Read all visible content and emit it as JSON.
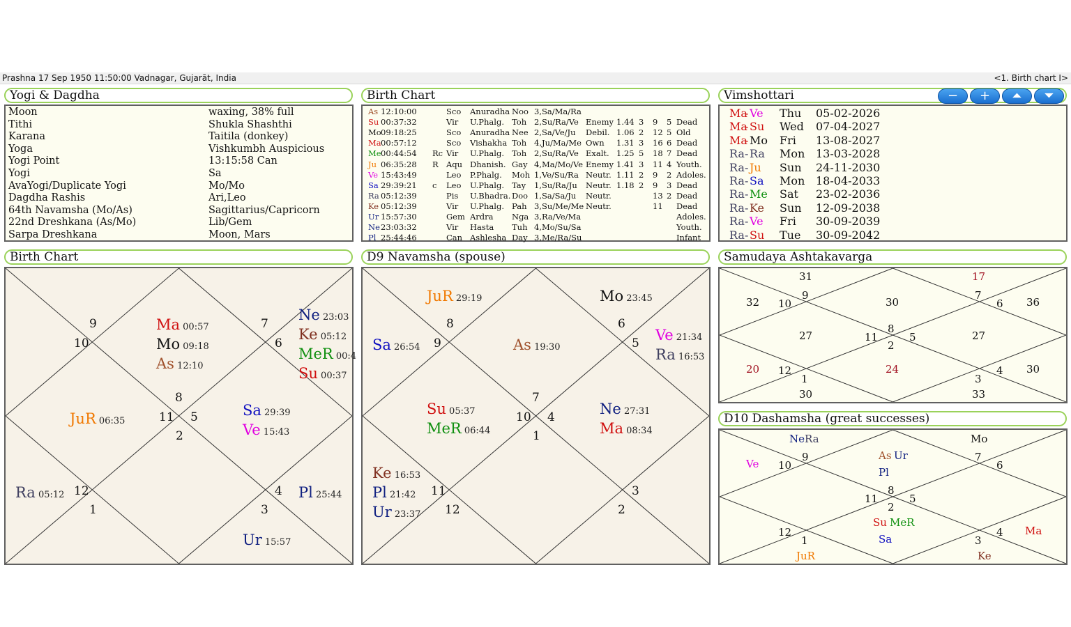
{
  "header": {
    "left": "Prashna 17 Sep 1950 11:50:00  Vadnagar, Gujarāt, India",
    "right": "<1. Birth chart I>"
  },
  "colors": {
    "As": "#a0522d",
    "Su": "#d01010",
    "Mo": "#111111",
    "Ma": "#d01010",
    "Me": "#109010",
    "Ju": "#f07800",
    "Ve": "#e000e0",
    "Sa": "#1010c0",
    "Ra": "#404060",
    "Ke": "#803020",
    "Ur": "#102080",
    "Ne": "#102080",
    "Pl": "#102080",
    "accent": "#9ad25a"
  },
  "yogi": {
    "title": "Yogi & Dagdha",
    "rows": [
      {
        "k": "Moon",
        "v": "waxing, 38% full"
      },
      {
        "k": "Tithi",
        "v": "Shukla Shashthi"
      },
      {
        "k": "Karana",
        "v": "Taitila (donkey)"
      },
      {
        "k": "Yoga",
        "v": "Vishkumbh Auspicious"
      },
      {
        "k": "Yogi Point",
        "v": "13:15:58 Can"
      },
      {
        "k": "Yogi",
        "v": "Sa"
      },
      {
        "k": "AvaYogi/Duplicate Yogi",
        "v": "Mo/Mo"
      },
      {
        "k": "Dagdha Rashis",
        "v": "Ari,Leo"
      },
      {
        "k": "64th Navamsha (Mo/As)",
        "v": "Sagittarius/Capricorn"
      },
      {
        "k": "22nd Dreshkana (As/Mo)",
        "v": "Lib/Gem"
      },
      {
        "k": "Sarpa Dreshkana",
        "v": "Moon, Mars"
      }
    ]
  },
  "birth_table": {
    "title": "Birth Chart",
    "rows": [
      {
        "p": "As",
        "c": "As",
        "deg": "12:10:00",
        "rc": "",
        "sign": "Sco",
        "nak": "Anuradha",
        "nak2": "Noo",
        "lords": "3,Sa/Ma/Ra",
        "dig": "",
        "sh": "",
        "n1": "",
        "n2": "",
        "n3": "",
        "age": ""
      },
      {
        "p": "Su",
        "c": "Su",
        "deg": "00:37:32",
        "rc": "",
        "sign": "Vir",
        "nak": "U.Phalg.",
        "nak2": "Toh",
        "lords": "2,Su/Ra/Ve",
        "dig": "Enemy",
        "sh": "1.44",
        "n1": "3",
        "n2": "9",
        "n3": "5",
        "age": "Dead"
      },
      {
        "p": "Mo",
        "c": "Mo",
        "deg": "09:18:25",
        "rc": "",
        "sign": "Sco",
        "nak": "Anuradha",
        "nak2": "Nee",
        "lords": "2,Sa/Ve/Ju",
        "dig": "Debil.",
        "sh": "1.06",
        "n1": "2",
        "n2": "12",
        "n3": "5",
        "age": "Old"
      },
      {
        "p": "Ma",
        "c": "Ma",
        "deg": "00:57:12",
        "rc": "",
        "sign": "Sco",
        "nak": "Vishakha",
        "nak2": "Toh",
        "lords": "4,Ju/Ma/Me",
        "dig": "Own",
        "sh": "1.31",
        "n1": "3",
        "n2": "16",
        "n3": "6",
        "age": "Dead"
      },
      {
        "p": "Me",
        "c": "Me",
        "deg": "00:44:54",
        "rc": "Rc",
        "sign": "Vir",
        "nak": "U.Phalg.",
        "nak2": "Toh",
        "lords": "2,Su/Ra/Ve",
        "dig": "Exalt.",
        "sh": "1.25",
        "n1": "5",
        "n2": "18",
        "n3": "7",
        "age": "Dead"
      },
      {
        "p": "Ju",
        "c": "Ju",
        "deg": "06:35:28",
        "rc": "R",
        "sign": "Aqu",
        "nak": "Dhanish.",
        "nak2": "Gay",
        "lords": "4,Ma/Mo/Ve",
        "dig": "Enemy",
        "sh": "1.41",
        "n1": "3",
        "n2": "11",
        "n3": "4",
        "age": "Youth."
      },
      {
        "p": "Ve",
        "c": "Ve",
        "deg": "15:43:49",
        "rc": "",
        "sign": "Leo",
        "nak": "P.Phalg.",
        "nak2": "Moh",
        "lords": "1,Ve/Su/Ra",
        "dig": "Neutr.",
        "sh": "1.11",
        "n1": "2",
        "n2": "9",
        "n3": "2",
        "age": "Adoles."
      },
      {
        "p": "Sa",
        "c": "Sa",
        "deg": "29:39:21",
        "rc": "c",
        "sign": "Leo",
        "nak": "U.Phalg.",
        "nak2": "Tay",
        "lords": "1,Su/Ra/Ju",
        "dig": "Neutr.",
        "sh": "1.18",
        "n1": "2",
        "n2": "9",
        "n3": "3",
        "age": "Dead"
      },
      {
        "p": "Ra",
        "c": "Ra",
        "deg": "05:12:39",
        "rc": "",
        "sign": "Pis",
        "nak": "U.Bhadra.",
        "nak2": "Doo",
        "lords": "1,Sa/Sa/Ju",
        "dig": "Neutr.",
        "sh": "",
        "n1": "",
        "n2": "13",
        "n3": "2",
        "age": "Dead"
      },
      {
        "p": "Ke",
        "c": "Ke",
        "deg": "05:12:39",
        "rc": "",
        "sign": "Vir",
        "nak": "U.Phalg.",
        "nak2": "Pah",
        "lords": "3,Su/Me/Me",
        "dig": "Neutr.",
        "sh": "",
        "n1": "",
        "n2": "11",
        "n3": "",
        "age": "Dead"
      },
      {
        "p": "Ur",
        "c": "Ur",
        "deg": "15:57:30",
        "rc": "",
        "sign": "Gem",
        "nak": "Ardra",
        "nak2": "Nga",
        "lords": "3,Ra/Ve/Ma",
        "dig": "",
        "sh": "",
        "n1": "",
        "n2": "",
        "n3": "",
        "age": "Adoles."
      },
      {
        "p": "Ne",
        "c": "Ne",
        "deg": "23:03:32",
        "rc": "",
        "sign": "Vir",
        "nak": "Hasta",
        "nak2": "Tuh",
        "lords": "4,Mo/Su/Sa",
        "dig": "",
        "sh": "",
        "n1": "",
        "n2": "",
        "n3": "",
        "age": "Youth."
      },
      {
        "p": "Pl",
        "c": "Pl",
        "deg": "25:44:46",
        "rc": "",
        "sign": "Can",
        "nak": "Ashlesha",
        "nak2": "Day",
        "lords": "3,Me/Ra/Su",
        "dig": "",
        "sh": "",
        "n1": "",
        "n2": "",
        "n3": "",
        "age": "Infant"
      }
    ]
  },
  "vimshottari": {
    "title": "Vimshottari",
    "buttons": [
      "−",
      "+",
      "⏶",
      "⏷"
    ],
    "rows": [
      {
        "a": "Ma",
        "ac": "Ma",
        "b": "Ve",
        "bc": "Ve",
        "day": "Thu",
        "date": "05-02-2026"
      },
      {
        "a": "Ma",
        "ac": "Ma",
        "b": "Su",
        "bc": "Su",
        "day": "Wed",
        "date": "07-04-2027"
      },
      {
        "a": "Ma",
        "ac": "Ma",
        "b": "Mo",
        "bc": "Mo",
        "day": "Fri",
        "date": "13-08-2027"
      },
      {
        "a": "Ra",
        "ac": "Ra",
        "b": "Ra",
        "bc": "Ra",
        "day": "Mon",
        "date": "13-03-2028"
      },
      {
        "a": "Ra",
        "ac": "Ra",
        "b": "Ju",
        "bc": "Ju",
        "day": "Sun",
        "date": "24-11-2030"
      },
      {
        "a": "Ra",
        "ac": "Ra",
        "b": "Sa",
        "bc": "Sa",
        "day": "Mon",
        "date": "18-04-2033"
      },
      {
        "a": "Ra",
        "ac": "Ra",
        "b": "Me",
        "bc": "Me",
        "day": "Sat",
        "date": "23-02-2036"
      },
      {
        "a": "Ra",
        "ac": "Ra",
        "b": "Ke",
        "bc": "Ke",
        "day": "Sun",
        "date": "12-09-2038"
      },
      {
        "a": "Ra",
        "ac": "Ra",
        "b": "Ve",
        "bc": "Ve",
        "day": "Fri",
        "date": "30-09-2039"
      },
      {
        "a": "Ra",
        "ac": "Ra",
        "b": "Su",
        "bc": "Su",
        "day": "Tue",
        "date": "30-09-2042"
      }
    ]
  },
  "birth_chart": {
    "title": "Birth Chart",
    "houses": [
      "9",
      "10",
      "7",
      "6",
      "8",
      "11",
      "5",
      "2",
      "12",
      "1",
      "4",
      "3"
    ],
    "planets": [
      {
        "n": "Ma",
        "c": "Ma",
        "d": "00:57"
      },
      {
        "n": "Mo",
        "c": "Mo",
        "d": "09:18"
      },
      {
        "n": "As",
        "c": "As",
        "d": "12:10"
      },
      {
        "n": "Ne",
        "c": "Ne",
        "d": "23:03"
      },
      {
        "n": "Ke",
        "c": "Ke",
        "d": "05:12"
      },
      {
        "n": "MeR",
        "c": "Me",
        "d": "00:4"
      },
      {
        "n": "Su",
        "c": "Su",
        "d": "00:37"
      },
      {
        "n": "JuR",
        "c": "Ju",
        "d": "06:35"
      },
      {
        "n": "Sa",
        "c": "Sa",
        "d": "29:39"
      },
      {
        "n": "Ve",
        "c": "Ve",
        "d": "15:43"
      },
      {
        "n": "Ra",
        "c": "Ra",
        "d": "05:12"
      },
      {
        "n": "Pl",
        "c": "Pl",
        "d": "25:44"
      },
      {
        "n": "Ur",
        "c": "Ur",
        "d": "15:57"
      }
    ],
    "edge_marks": [
      "57",
      "18",
      "0",
      "8"
    ]
  },
  "navamsha": {
    "title": "D9 Navamsha  (spouse)",
    "houses": [
      "8",
      "9",
      "6",
      "5",
      "7",
      "10",
      "4",
      "1",
      "11",
      "12",
      "3",
      "2"
    ],
    "planets": [
      {
        "n": "JuR",
        "c": "Ju",
        "d": "29:19"
      },
      {
        "n": "Mo",
        "c": "Mo",
        "d": "23:45"
      },
      {
        "n": "Sa",
        "c": "Sa",
        "d": "26:54"
      },
      {
        "n": "As",
        "c": "As",
        "d": "19:30"
      },
      {
        "n": "Ve",
        "c": "Ve",
        "d": "21:34"
      },
      {
        "n": "Ra",
        "c": "Ra",
        "d": "16:53"
      },
      {
        "n": "Su",
        "c": "Su",
        "d": "05:37"
      },
      {
        "n": "MeR",
        "c": "Me",
        "d": "06:44"
      },
      {
        "n": "Ne",
        "c": "Ne",
        "d": "27:31"
      },
      {
        "n": "Ma",
        "c": "Ma",
        "d": "08:34"
      },
      {
        "n": "Ke",
        "c": "Ke",
        "d": "16:53"
      },
      {
        "n": "Pl",
        "c": "Pl",
        "d": "21:42"
      },
      {
        "n": "Ur",
        "c": "Ur",
        "d": "23:37"
      }
    ]
  },
  "ashtakavarga": {
    "title": "Samudaya Ashtakavarga",
    "houses": [
      "9",
      "10",
      "7",
      "6",
      "8",
      "11",
      "5",
      "2",
      "12",
      "1",
      "4",
      "3"
    ],
    "scores": [
      "31",
      "17",
      "32",
      "30",
      "36",
      "27",
      "27",
      "20",
      "24",
      "30",
      "30",
      "33"
    ],
    "highlight": "#a01020"
  },
  "dashamsha": {
    "title": "D10 Dashamsha  (great successes)",
    "houses": [
      "9",
      "10",
      "7",
      "6",
      "8",
      "11",
      "5",
      "2",
      "12",
      "1",
      "4",
      "3"
    ],
    "labels": [
      {
        "n": "Ne",
        "c": "Ne"
      },
      {
        "n": "Ra",
        "c": "Ra"
      },
      {
        "n": "Mo",
        "c": "Mo"
      },
      {
        "n": "Ve",
        "c": "Ve"
      },
      {
        "n": "As",
        "c": "As"
      },
      {
        "n": "Ur",
        "c": "Ur"
      },
      {
        "n": "Pl",
        "c": "Pl"
      },
      {
        "n": "Su",
        "c": "Su"
      },
      {
        "n": "MeR",
        "c": "Me"
      },
      {
        "n": "Sa",
        "c": "Sa"
      },
      {
        "n": "Ma",
        "c": "Ma"
      },
      {
        "n": "JuR",
        "c": "Ju"
      },
      {
        "n": "Ke",
        "c": "Ke"
      }
    ]
  }
}
